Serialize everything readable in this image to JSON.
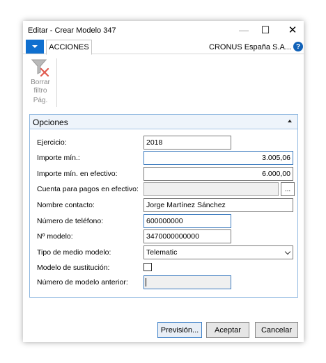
{
  "window": {
    "title": "Editar - Crear Modelo 347",
    "minimize_glyph": "—",
    "maximize_glyph": "☐",
    "close_glyph": "✕"
  },
  "ribbon": {
    "tab_label": "ACCIONES",
    "company": "CRONUS España S.A...",
    "help_glyph": "?",
    "clear_filter_label": "Borrar filtro",
    "group_label": "Pág."
  },
  "options": {
    "title": "Opciones",
    "fields": {
      "ejercicio": {
        "label": "Ejercicio:",
        "value": "2018"
      },
      "importe_min": {
        "label": "Importe mín.:",
        "value": "3.005,06"
      },
      "importe_min_efectivo": {
        "label": "Importe mín. en efectivo:",
        "value": "6.000,00"
      },
      "cuenta_pagos_efectivo": {
        "label": "Cuenta para pagos en efectivo:",
        "value": "",
        "lookup_glyph": "..."
      },
      "nombre_contacto": {
        "label": "Nombre contacto:",
        "value": "Jorge Martínez Sánchez"
      },
      "telefono": {
        "label": "Número de teléfono:",
        "value": "600000000"
      },
      "n_modelo": {
        "label": "Nº modelo:",
        "value": "3470000000000"
      },
      "tipo_medio": {
        "label": "Tipo de medio modelo:",
        "value": "Telematic"
      },
      "modelo_sustitucion": {
        "label": "Modelo de sustitución:",
        "checked": false
      },
      "numero_modelo_anterior": {
        "label": "Número de modelo anterior:",
        "value": ""
      }
    }
  },
  "buttons": {
    "prevision": "Previsión...",
    "aceptar": "Aceptar",
    "cancelar": "Cancelar"
  },
  "colors": {
    "accent": "#0f6fcf",
    "fasttab_border": "#8fb8e0",
    "clear_filter_x": "#e05a4f"
  },
  "icons": {
    "clear_filter": "funnel-with-red-x-icon",
    "lookup": "ellipsis-icon",
    "dropdown": "chevron-down-icon",
    "collapse": "caret-up-icon",
    "help": "help-circle-icon"
  }
}
